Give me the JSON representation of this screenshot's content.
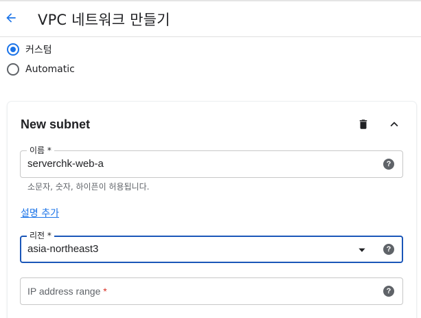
{
  "header": {
    "title": "VPC 네트워크 만들기",
    "back_icon": "arrow-back-icon"
  },
  "subnet_mode": {
    "options": [
      {
        "label": "커스텀",
        "selected": true
      },
      {
        "label": "Automatic",
        "selected": false
      }
    ]
  },
  "subnet_card": {
    "title": "New subnet",
    "delete_icon": "trash-icon",
    "collapse_icon": "chevron-up-icon",
    "name_field": {
      "label": "이름",
      "required_mark": "*",
      "value": "serverchk-web-a",
      "hint": "소문자, 숫자, 하이픈이 허용됩니다."
    },
    "add_description_link": "설명 추가",
    "region_field": {
      "label": "리전",
      "required_mark": "*",
      "value": "asia-northeast3"
    },
    "ip_range_field": {
      "placeholder": "IP address range",
      "required_mark": "*"
    }
  },
  "colors": {
    "accent": "#1a73e8",
    "focus_border": "#1a56b8",
    "required": "#d93025",
    "icon": "#5f6368"
  }
}
